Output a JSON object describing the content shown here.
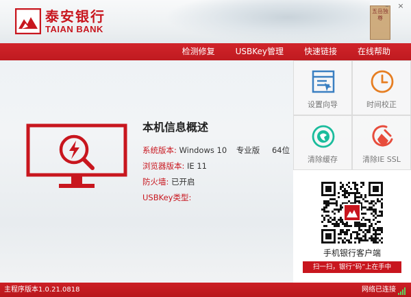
{
  "header": {
    "bank_name_cn": "泰安银行",
    "bank_name_en": "TAIAN BANK",
    "badge_text": "五岳独尊"
  },
  "window_controls": {
    "minimize": "–",
    "close": "×"
  },
  "nav": {
    "items": [
      {
        "label": "检测修复"
      },
      {
        "label": "USBKey管理"
      },
      {
        "label": "快速链接"
      },
      {
        "label": "在线帮助"
      }
    ]
  },
  "info": {
    "title": "本机信息概述",
    "os_label": "系统版本:",
    "os_value": "Windows 10",
    "os_edition": "专业版",
    "os_bits": "64位",
    "browser_label": "浏览器版本:",
    "browser_value": "IE 11",
    "firewall_label": "防火墙:",
    "firewall_value": "已开启",
    "usbkey_label": "USBKey类型:",
    "usbkey_value": ""
  },
  "tools": [
    {
      "label": "设置向导",
      "icon": "settings-guide-icon"
    },
    {
      "label": "时间校正",
      "icon": "clock-icon"
    },
    {
      "label": "清除缓存",
      "icon": "clear-cache-icon"
    },
    {
      "label": "清除IE SSL",
      "icon": "broom-icon"
    }
  ],
  "qr": {
    "caption": "手机银行客户端",
    "slogan": "扫一扫，银行“码”上在手中"
  },
  "status": {
    "version": "主程序版本1.0.21.0818",
    "network": "网络已连接"
  },
  "colors": {
    "brand_red": "#c8161e",
    "tool_red": "#e74c3c",
    "tool_blue": "#3a7fc1",
    "tool_orange": "#e67e22",
    "tool_green": "#1abc9c"
  }
}
